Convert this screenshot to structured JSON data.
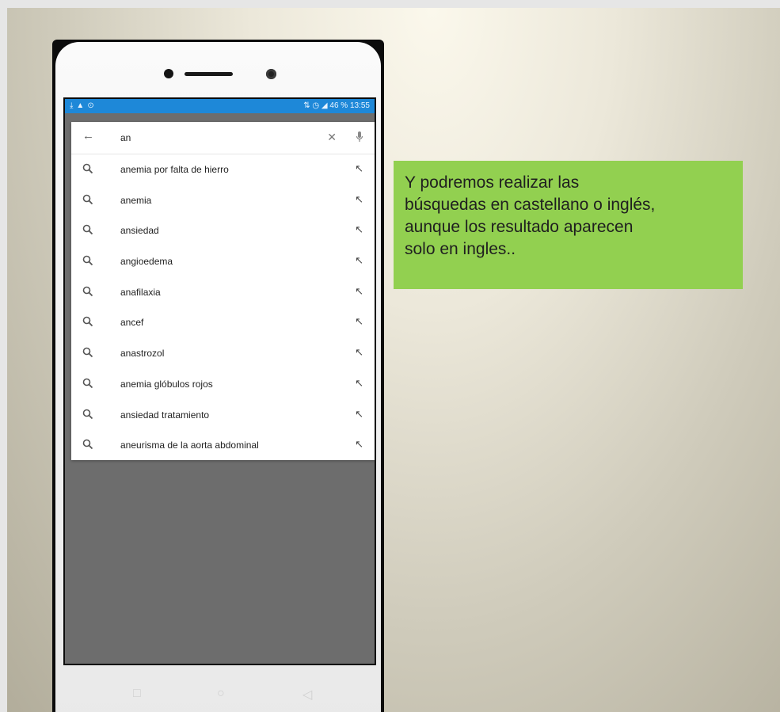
{
  "status_bar": {
    "left_icons": [
      "download-icon",
      "warning-icon",
      "sync-icon"
    ],
    "right_text": "46 % 13:55"
  },
  "search": {
    "query": "an",
    "suggestions": [
      "anemia por falta de hierro",
      "anemia",
      "ansiedad",
      "angioedema",
      "anafilaxia",
      "ancef",
      "anastrozol",
      "anemia glóbulos rojos",
      "ansiedad tratamiento",
      "aneurisma de la aorta abdominal"
    ]
  },
  "caption": {
    "text": "Y podremos realizar las\nbúsquedas en castellano o inglés,\naunque los resultado aparecen\nsolo en ingles.."
  },
  "colors": {
    "status_bar": "#1e88d8",
    "caption_bg": "#92d050",
    "screen_bg": "#6d6d6d"
  }
}
